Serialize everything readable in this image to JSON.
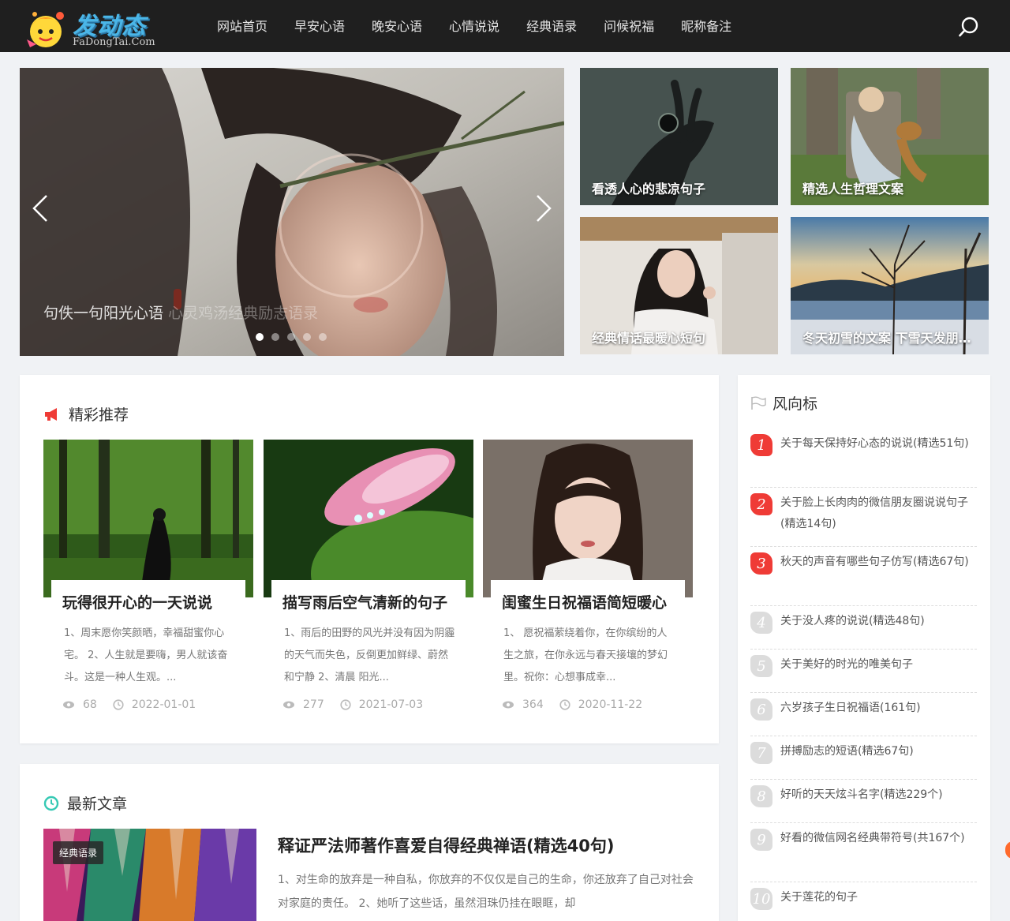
{
  "header": {
    "logo_title": "发动态",
    "logo_sub": "FaDongTai.Com",
    "nav": [
      "网站首页",
      "早安心语",
      "晚安心语",
      "心情说说",
      "经典语录",
      "问候祝福",
      "昵称备注"
    ]
  },
  "slider": {
    "caption_main": "句佚一句阳光心语",
    "caption_ghost": "心灵鸡汤经典励志语录",
    "dot_count": 5,
    "active_dot": 0
  },
  "thumbs": [
    {
      "label": "看透人心的悲凉句子"
    },
    {
      "label": "精选人生哲理文案"
    },
    {
      "label": "经典情话最暖心短句"
    },
    {
      "label": "冬天初雪的文案 下雪天发朋友圈的句子"
    }
  ],
  "featured": {
    "title": "精彩推荐",
    "cards": [
      {
        "title": "玩得很开心的一天说说",
        "excerpt": "1、周末愿你笑颜晒，幸福甜蜜你心宅。 2、人生就是要嗨，男人就该奋斗。这是一种人生观。...",
        "views": "68",
        "date": "2022-01-01"
      },
      {
        "title": "描写雨后空气清新的句子",
        "excerpt": "1、雨后的田野的风光并没有因为阴霾的天气而失色，反倒更加鲜绿、蔚然和宁静 2、清晨 阳光...",
        "views": "277",
        "date": "2021-07-03"
      },
      {
        "title": "闺蜜生日祝福语简短暖心",
        "excerpt": "1、 愿祝福萦绕着你，在你缤纷的人生之旅，在你永远与春天接壤的梦幻里。祝你：心想事成幸...",
        "views": "364",
        "date": "2020-11-22"
      }
    ]
  },
  "latest": {
    "title": "最新文章",
    "tag": "经典语录",
    "article_title": "释证严法师著作喜爱自得经典禅语(精选40句)",
    "excerpt": "1、对生命的放弃是一种自私，你放弃的不仅仅是自己的生命，你还放弃了自己对社会对家庭的责任。 2、她听了这些话，虽然泪珠仍挂在眼眶，却"
  },
  "sidebar": {
    "title": "风向标",
    "items": [
      {
        "rank": "1",
        "text": "关于每天保持好心态的说说(精选51句)",
        "hot": true
      },
      {
        "rank": "2",
        "text": "关于脸上长肉肉的微信朋友圈说说句子(精选14句)",
        "hot": true
      },
      {
        "rank": "3",
        "text": "秋天的声音有哪些句子仿写(精选67句)",
        "hot": true
      },
      {
        "rank": "4",
        "text": "关于没人疼的说说(精选48句)",
        "hot": false
      },
      {
        "rank": "5",
        "text": "关于美好的时光的唯美句子",
        "hot": false
      },
      {
        "rank": "6",
        "text": "六岁孩子生日祝福语(161句)",
        "hot": false
      },
      {
        "rank": "7",
        "text": "拼搏励志的短语(精选67句)",
        "hot": false
      },
      {
        "rank": "8",
        "text": "好听的天天炫斗名字(精选229个)",
        "hot": false
      },
      {
        "rank": "9",
        "text": "好看的微信网名经典带符号(共167个)",
        "hot": false
      },
      {
        "rank": "10",
        "text": "关于莲花的句子",
        "hot": false
      }
    ]
  },
  "colors": {
    "header_bg": "#1f1f1f",
    "hot_rank": "#ef3b36",
    "featured_icon": "#ef3b36",
    "latest_icon": "#36c9b4"
  }
}
